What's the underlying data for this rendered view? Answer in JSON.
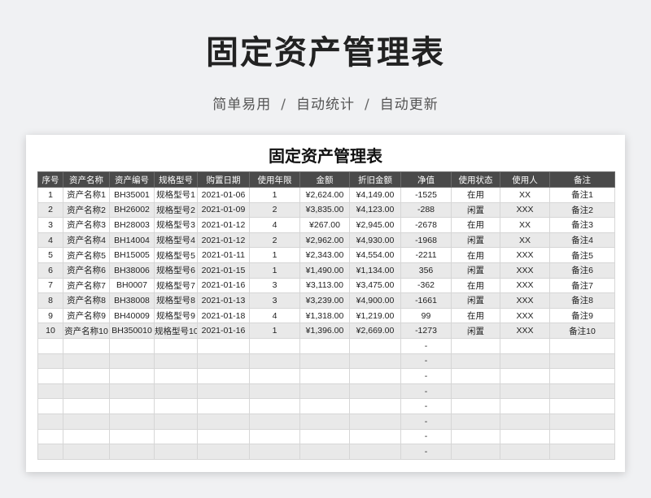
{
  "header": {
    "title": "固定资产管理表",
    "subtitle_parts": [
      "简单易用",
      "自动统计",
      "自动更新"
    ],
    "separator": "/"
  },
  "sheet": {
    "title": "固定资产管理表",
    "columns": [
      "序号",
      "资产名称",
      "资产编号",
      "规格型号",
      "购置日期",
      "使用年限",
      "金额",
      "折旧金额",
      "净值",
      "使用状态",
      "使用人",
      "备注"
    ],
    "rows": [
      [
        "1",
        "资产名称1",
        "BH35001",
        "规格型号1",
        "2021-01-06",
        "1",
        "¥2,624.00",
        "¥4,149.00",
        "-1525",
        "在用",
        "XX",
        "备注1"
      ],
      [
        "2",
        "资产名称2",
        "BH26002",
        "规格型号2",
        "2021-01-09",
        "2",
        "¥3,835.00",
        "¥4,123.00",
        "-288",
        "闲置",
        "XXX",
        "备注2"
      ],
      [
        "3",
        "资产名称3",
        "BH28003",
        "规格型号3",
        "2021-01-12",
        "4",
        "¥267.00",
        "¥2,945.00",
        "-2678",
        "在用",
        "XX",
        "备注3"
      ],
      [
        "4",
        "资产名称4",
        "BH14004",
        "规格型号4",
        "2021-01-12",
        "2",
        "¥2,962.00",
        "¥4,930.00",
        "-1968",
        "闲置",
        "XX",
        "备注4"
      ],
      [
        "5",
        "资产名称5",
        "BH15005",
        "规格型号5",
        "2021-01-11",
        "1",
        "¥2,343.00",
        "¥4,554.00",
        "-2211",
        "在用",
        "XXX",
        "备注5"
      ],
      [
        "6",
        "资产名称6",
        "BH38006",
        "规格型号6",
        "2021-01-15",
        "1",
        "¥1,490.00",
        "¥1,134.00",
        "356",
        "闲置",
        "XXX",
        "备注6"
      ],
      [
        "7",
        "资产名称7",
        "BH0007",
        "规格型号7",
        "2021-01-16",
        "3",
        "¥3,113.00",
        "¥3,475.00",
        "-362",
        "在用",
        "XXX",
        "备注7"
      ],
      [
        "8",
        "资产名称8",
        "BH38008",
        "规格型号8",
        "2021-01-13",
        "3",
        "¥3,239.00",
        "¥4,900.00",
        "-1661",
        "闲置",
        "XXX",
        "备注8"
      ],
      [
        "9",
        "资产名称9",
        "BH40009",
        "规格型号9",
        "2021-01-18",
        "4",
        "¥1,318.00",
        "¥1,219.00",
        "99",
        "在用",
        "XXX",
        "备注9"
      ],
      [
        "10",
        "资产名称10",
        "BH350010",
        "规格型号10",
        "2021-01-16",
        "1",
        "¥1,396.00",
        "¥2,669.00",
        "-1273",
        "闲置",
        "XXX",
        "备注10"
      ],
      [
        "",
        "",
        "",
        "",
        "",
        "",
        "",
        "",
        "-",
        "",
        "",
        ""
      ],
      [
        "",
        "",
        "",
        "",
        "",
        "",
        "",
        "",
        "-",
        "",
        "",
        ""
      ],
      [
        "",
        "",
        "",
        "",
        "",
        "",
        "",
        "",
        "-",
        "",
        "",
        ""
      ],
      [
        "",
        "",
        "",
        "",
        "",
        "",
        "",
        "",
        "-",
        "",
        "",
        ""
      ],
      [
        "",
        "",
        "",
        "",
        "",
        "",
        "",
        "",
        "-",
        "",
        "",
        ""
      ],
      [
        "",
        "",
        "",
        "",
        "",
        "",
        "",
        "",
        "-",
        "",
        "",
        ""
      ],
      [
        "",
        "",
        "",
        "",
        "",
        "",
        "",
        "",
        "-",
        "",
        "",
        ""
      ],
      [
        "",
        "",
        "",
        "",
        "",
        "",
        "",
        "",
        "-",
        "",
        "",
        ""
      ]
    ]
  }
}
